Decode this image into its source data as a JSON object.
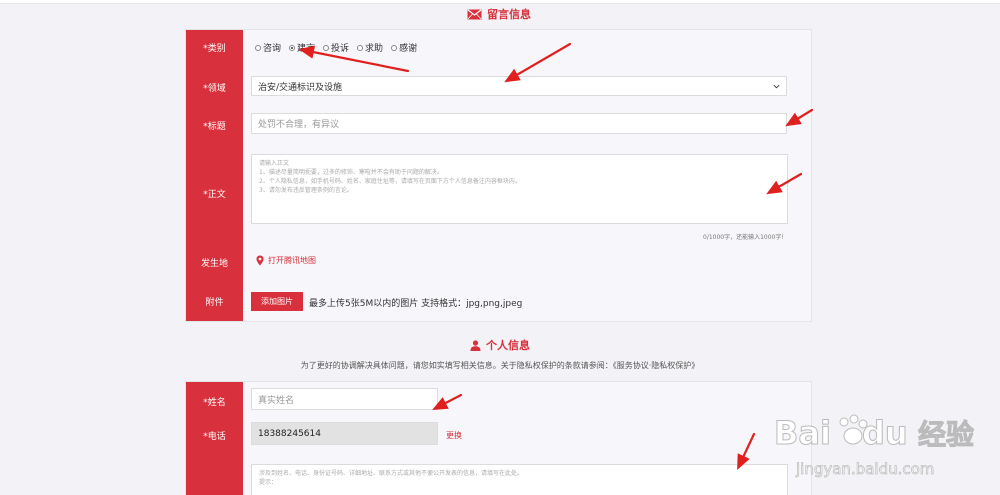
{
  "message_section": {
    "title": "留言信息",
    "category": {
      "label": "*类别",
      "options": [
        {
          "label": "咨询",
          "selected": false
        },
        {
          "label": "建言",
          "selected": true
        },
        {
          "label": "投诉",
          "selected": false
        },
        {
          "label": "求助",
          "selected": false
        },
        {
          "label": "感谢",
          "selected": false
        }
      ]
    },
    "domain": {
      "label": "*领域",
      "value": "治安/交通标识及设施"
    },
    "subject": {
      "label": "*标题",
      "value": "处罚不合理，有异议"
    },
    "body": {
      "label": "*正文",
      "placeholder": "请输入正文\n1、描述尽量简明扼要，过多的修饰、寒暄并不会有助于问题的解决。\n2、个人隐私信息，如手机号码、姓名、家庭住址等，请填写在页面下方个人信息备注内容框块内。\n3、请勿发布违反管理条例的言论。",
      "counter": "0/1000字，还能输入1000字!"
    },
    "location": {
      "label": "发生地",
      "link_text": "打开腾讯地图"
    },
    "attachment": {
      "label": "附件",
      "button": "添加图片",
      "hint": "最多上传5张5M以内的图片 支持格式：jpg,png,jpeg"
    }
  },
  "personal_section": {
    "title": "个人信息",
    "note": "为了更好的协调解决具体问题，请您如实填写相关信息。关于隐私权保护的条款请参阅：《服务协议·隐私权保护》",
    "name": {
      "label": "*姓名",
      "placeholder": "真实姓名"
    },
    "phone": {
      "label": "*电话",
      "value": "18388245614",
      "change": "更换"
    },
    "remark": {
      "placeholder": "涉及到姓名、电话、身份证号码、详细地址、联系方式或其他不便公开发表的信息，请填写在此处。\n提示："
    }
  },
  "watermark": {
    "brand_main": "Bai",
    "brand_du": "du",
    "brand_cn": "经验",
    "url": "jingyan.baidu.com"
  },
  "colors": {
    "accent": "#d8303c",
    "arrow": "#e0201e"
  }
}
